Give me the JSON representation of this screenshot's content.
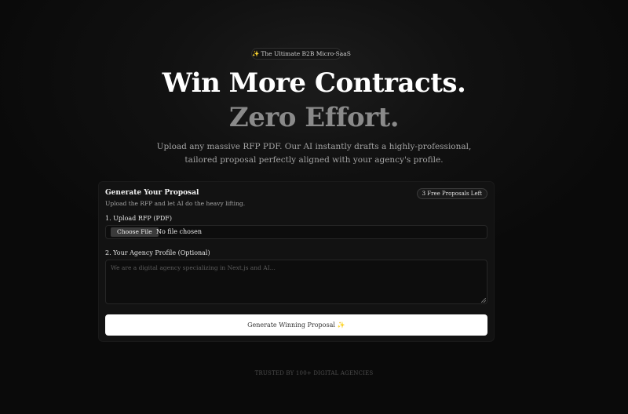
{
  "badge": {
    "icon": "sparkles-icon",
    "text": "The Ultimate B2B Micro-SaaS"
  },
  "hero": {
    "title": "Win More Contracts.",
    "subtitle": "Zero Effort.",
    "description": "Upload any massive RFP PDF. Our AI instantly drafts a highly-professional, tailored proposal perfectly aligned with your agency's profile."
  },
  "card": {
    "title": "Generate Your Proposal",
    "description": "Upload the RFP and let AI do the heavy lifting.",
    "counter": "3 Free Proposals Left",
    "rfp_label": "1. Upload RFP (PDF)",
    "file_button": "Choose File",
    "file_status": "No file chosen",
    "profile_label": "2. Your Agency Profile (Optional)",
    "profile_placeholder": "We are a digital agency specializing in Next.js and AI...",
    "generate_label": "Generate Winning Proposal",
    "generate_icon": "sparkles-icon"
  },
  "footer": {
    "trusted": "TRUSTED BY 100+ DIGITAL AGENCIES"
  },
  "colors": {
    "background": "#0a0a0a",
    "card": "#121212",
    "accent_spark": "#f5c542"
  }
}
